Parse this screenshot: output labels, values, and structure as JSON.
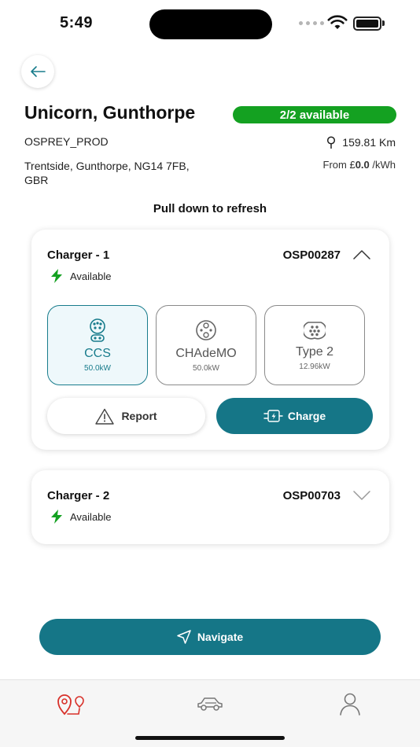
{
  "status_bar": {
    "time": "5:49"
  },
  "site": {
    "title": "Unicorn, Gunthorpe",
    "availability": "2/2 available",
    "network": "OSPREY_PROD",
    "distance": "159.81 Km",
    "address": "Trentside, Gunthorpe, NG14 7FB, GBR",
    "price_prefix": "From £",
    "price_value": "0.0",
    "price_unit": " /kWh"
  },
  "refresh_hint": "Pull down to refresh",
  "chargers": [
    {
      "name": "Charger - 1",
      "id": "OSP00287",
      "status": "Available",
      "connectors": [
        {
          "type": "CCS",
          "power": "50.0kW",
          "selected": true
        },
        {
          "type": "CHAdeMO",
          "power": "50.0kW",
          "selected": false
        },
        {
          "type": "Type 2",
          "power": "12.96kW",
          "selected": false
        }
      ],
      "report_label": "Report",
      "charge_label": "Charge"
    },
    {
      "name": "Charger - 2",
      "id": "OSP00703",
      "status": "Available"
    }
  ],
  "navigate_label": "Navigate",
  "colors": {
    "accent": "#157687",
    "available_green": "#14a121",
    "tab_active": "#d8312a"
  },
  "tabs": [
    {
      "icon": "map-pin-route-icon",
      "active": true
    },
    {
      "icon": "car-icon",
      "active": false
    },
    {
      "icon": "profile-icon",
      "active": false
    }
  ]
}
